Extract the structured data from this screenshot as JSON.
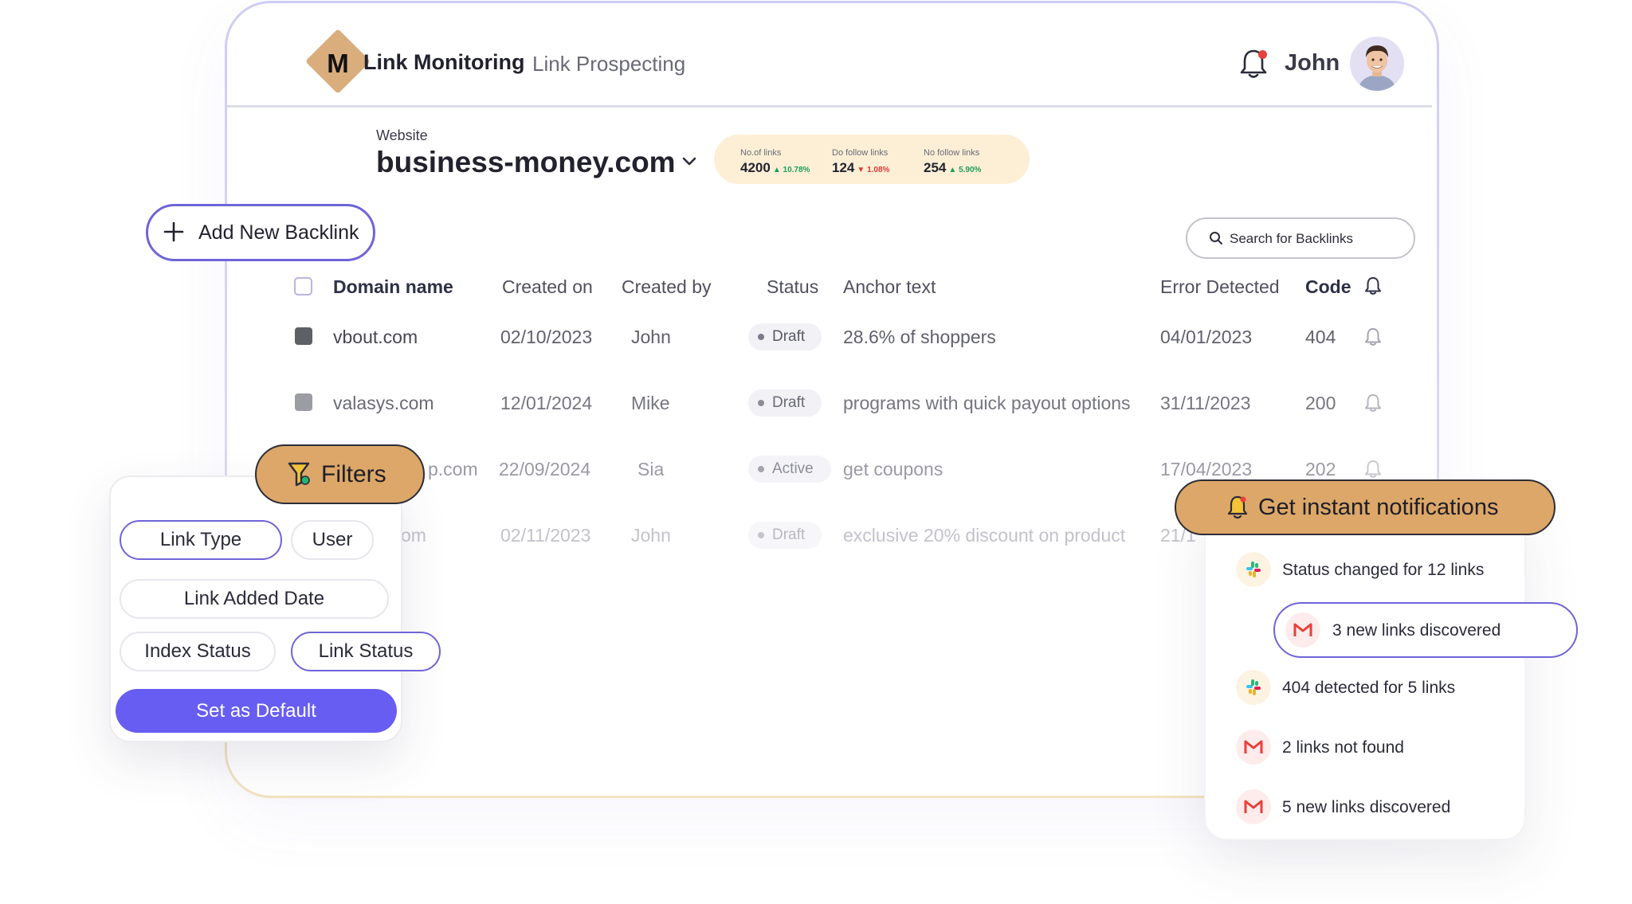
{
  "header": {
    "logo_letter": "M",
    "nav_active": "Link Monitoring",
    "nav_other": "Link Prospecting",
    "user_name": "John"
  },
  "website": {
    "label": "Website",
    "name": "business-money.com",
    "stats": [
      {
        "label": "No.of links",
        "value": "4200",
        "change": "10.78%",
        "direction": "up"
      },
      {
        "label": "Do follow links",
        "value": "124",
        "change": "1.08%",
        "direction": "down"
      },
      {
        "label": "No follow links",
        "value": "254",
        "change": "5.90%",
        "direction": "up"
      }
    ]
  },
  "actions": {
    "add_label": "Add New Backlink",
    "search_placeholder": "Search for Backlinks"
  },
  "table": {
    "headers": {
      "domain": "Domain name",
      "created_on": "Created on",
      "created_by": "Created by",
      "status": "Status",
      "anchor": "Anchor text",
      "error": "Error Detected",
      "code": "Code"
    },
    "rows": [
      {
        "domain": "vbout.com",
        "created_on": "02/10/2023",
        "created_by": "John",
        "status": "Draft",
        "anchor": "28.6% of shoppers",
        "error": "04/01/2023",
        "code": "404"
      },
      {
        "domain": "valasys.com",
        "created_on": "12/01/2024",
        "created_by": "Mike",
        "status": "Draft",
        "anchor": "programs with quick payout options",
        "error": "31/11/2023",
        "code": "200"
      },
      {
        "domain": "p.com",
        "created_on": "22/09/2024",
        "created_by": "Sia",
        "status": "Active",
        "anchor": "get coupons",
        "error": "17/04/2023",
        "code": "202"
      },
      {
        "domain": "om",
        "created_on": "02/11/2023",
        "created_by": "John",
        "status": "Draft",
        "anchor": "exclusive 20% discount on product",
        "error": "21/1",
        "code": ""
      }
    ]
  },
  "filters": {
    "title": "Filters",
    "chips": [
      "Link Type",
      "User",
      "Link Added Date",
      "Index Status",
      "Link Status"
    ],
    "default_button": "Set as Default"
  },
  "notifications": {
    "title": "Get instant notifications",
    "items": [
      {
        "text": "Status changed for 12 links",
        "icon": "slack-icon"
      },
      {
        "text": "3 new links discovered",
        "icon": "gmail-icon"
      },
      {
        "text": "404 detected for 5 links",
        "icon": "slack-icon"
      },
      {
        "text": "2 links not found",
        "icon": "gmail-icon"
      },
      {
        "text": "5 new links discovered",
        "icon": "gmail-icon"
      }
    ]
  },
  "colors": {
    "accent": "#675df2",
    "outline": "#6f64d9",
    "tab_fill": "#dca768",
    "logo": "#d9ad7c",
    "stats_bg": "#fcefd6"
  }
}
